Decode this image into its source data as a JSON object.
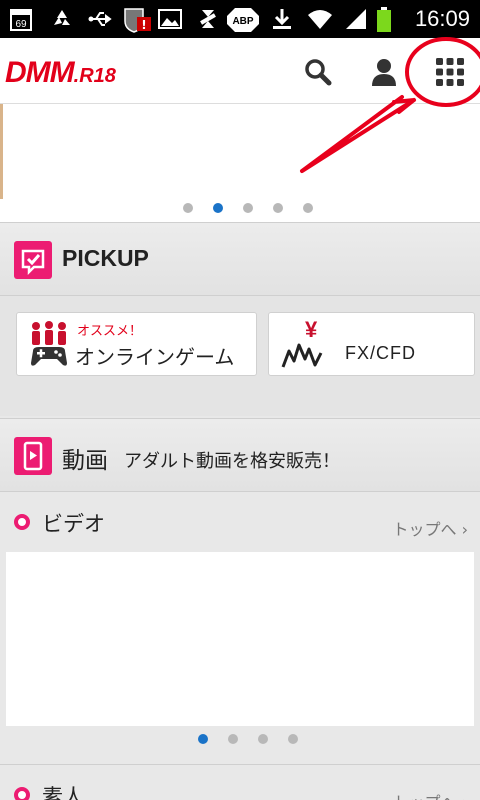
{
  "status_bar": {
    "time": "16:09",
    "calendar_day": "69",
    "icons": [
      "calendar-icon",
      "recycle-icon",
      "usb-icon",
      "shield-alert-icon",
      "image-icon",
      "sync-icon",
      "adblock-icon",
      "download-icon",
      "wifi-icon",
      "signal-icon",
      "battery-icon"
    ]
  },
  "header": {
    "logo_main": "DMM",
    "logo_sub": ".R18",
    "actions": [
      "search-icon",
      "user-icon",
      "grid-menu-icon"
    ]
  },
  "banner": {
    "dot_count": 5,
    "active_dot": 2
  },
  "pickup": {
    "title": "PICKUP",
    "items": [
      {
        "tag": "オススメ！",
        "label": "オンラインゲーム",
        "icon": "game-controller-icon"
      },
      {
        "tag": "",
        "label": "FX/CFD",
        "icon": "fx-chart-icon",
        "symbol": "¥"
      }
    ]
  },
  "video_section": {
    "title": "動画",
    "subtitle": "アダルト動画を格安販売！",
    "rows": [
      {
        "title": "ビデオ",
        "link": "トップへ ›"
      },
      {
        "title": "素人",
        "link": "トップへ ›"
      }
    ],
    "dot_count": 4,
    "active_dot": 1
  },
  "annotation": {
    "color": "#e8001c",
    "shape": "circle-with-arrow"
  },
  "colors": {
    "brand_red": "#e2001a",
    "pink": "#ec1c72",
    "accent_blue": "#1a73c8"
  }
}
